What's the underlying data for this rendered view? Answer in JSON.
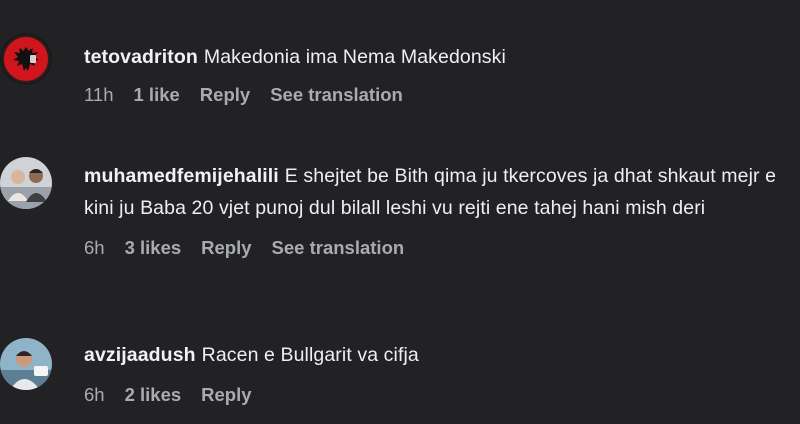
{
  "comments": [
    {
      "username": "tetovadriton",
      "text": "Makedonia ima Nema Makedonski",
      "time": "11h",
      "likes": "1 like",
      "reply_label": "Reply",
      "translate_label": "See translation",
      "avatar_icon": "albanian-eagle-flag-icon"
    },
    {
      "username": "muhamedfemijehalili",
      "text": "E shejtet be Bith qima ju tkercoves ja dhat shkaut mejr e kini ju Baba 20 vjet punoj dul bilall leshi vu rejti ene tahej hani mish deri",
      "time": "6h",
      "likes": "3 likes",
      "reply_label": "Reply",
      "translate_label": "See translation",
      "avatar_icon": "group-photo-icon"
    },
    {
      "username": "avzijaadush",
      "text": "Racen e Bullgarit va cifja",
      "time": "6h",
      "likes": "2 likes",
      "reply_label": "Reply",
      "avatar_icon": "person-photo-icon"
    }
  ],
  "colors": {
    "background": "#222225",
    "text": "#eceff3",
    "meta": "#a8abb2",
    "flag_red": "#d0161c"
  }
}
